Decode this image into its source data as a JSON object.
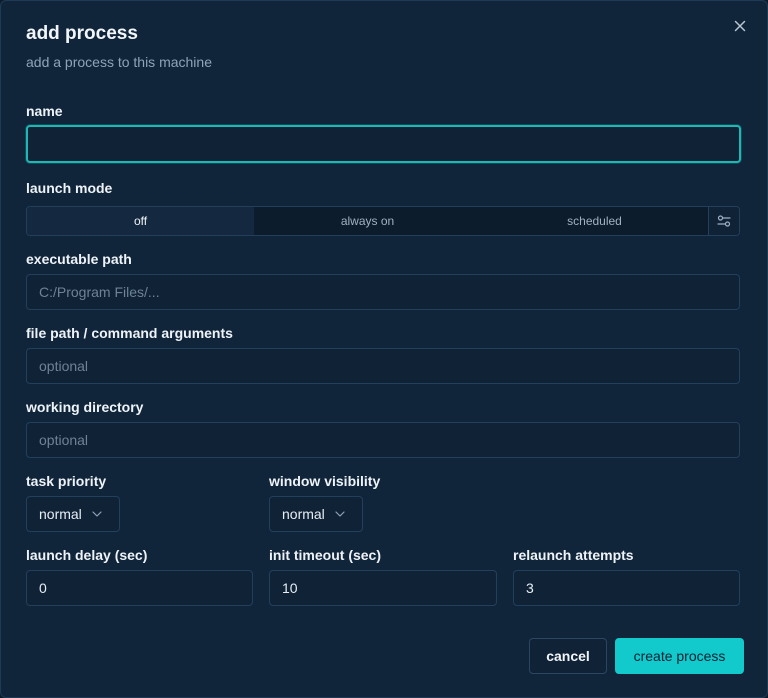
{
  "dialog": {
    "title": "add process",
    "subtitle": "add a process to this machine"
  },
  "fields": {
    "name": {
      "label": "name",
      "value": ""
    },
    "launch_mode": {
      "label": "launch mode",
      "options": [
        "off",
        "always on",
        "scheduled"
      ],
      "selected": "off"
    },
    "executable_path": {
      "label": "executable path",
      "placeholder": "C:/Program Files/..."
    },
    "arguments": {
      "label": "file path / command arguments",
      "placeholder": "optional"
    },
    "working_directory": {
      "label": "working directory",
      "placeholder": "optional"
    },
    "task_priority": {
      "label": "task priority",
      "value": "normal"
    },
    "window_visibility": {
      "label": "window visibility",
      "value": "normal"
    },
    "launch_delay": {
      "label": "launch delay (sec)",
      "value": "0"
    },
    "init_timeout": {
      "label": "init timeout (sec)",
      "value": "10"
    },
    "relaunch_attempts": {
      "label": "relaunch attempts",
      "value": "3"
    }
  },
  "actions": {
    "cancel": "cancel",
    "create": "create process"
  },
  "icons": {
    "close": "close-icon",
    "settings": "sliders-icon",
    "chevron": "chevron-down-icon"
  },
  "colors": {
    "accent": "#12c9cc",
    "background": "#11253a",
    "focus_ring": "#1fb7b3"
  }
}
